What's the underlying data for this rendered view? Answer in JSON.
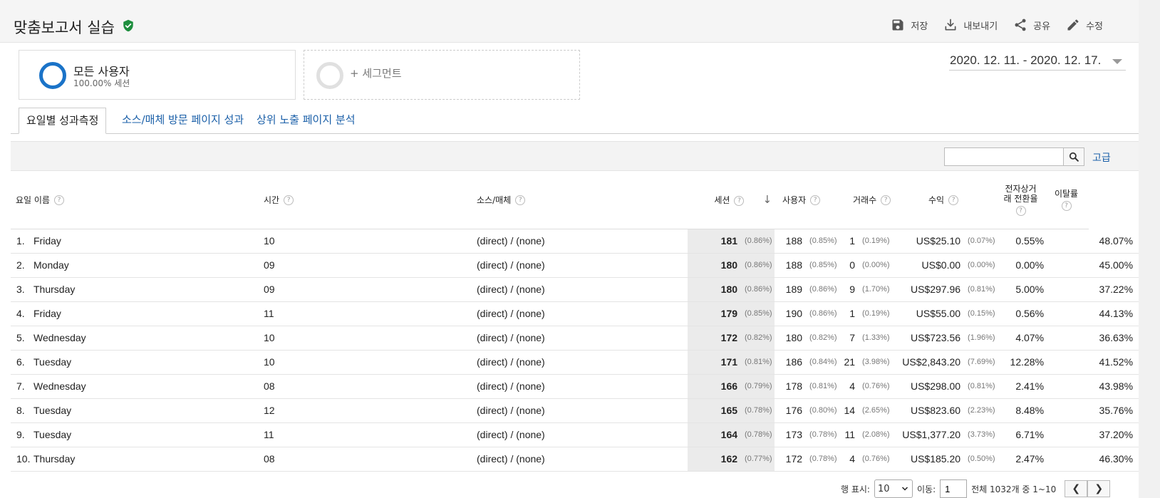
{
  "header": {
    "title": "맞춤보고서 실습",
    "actions": [
      {
        "label": "저장",
        "icon": "save-icon"
      },
      {
        "label": "내보내기",
        "icon": "download-icon"
      },
      {
        "label": "공유",
        "icon": "share-icon"
      },
      {
        "label": "수정",
        "icon": "pencil-icon"
      }
    ]
  },
  "segments": {
    "primary": {
      "name": "모든 사용자",
      "sub": "100.00% 세션"
    },
    "add_label": "+ 세그먼트"
  },
  "date_range": "2020. 12. 11. - 2020. 12. 17.",
  "tabs": [
    {
      "label": "요일별 성과측정"
    },
    {
      "label": "소스/매체 방문 페이지 성과"
    },
    {
      "label": "상위 노출 페이지 분석"
    }
  ],
  "filter": {
    "advanced_label": "고급",
    "search_placeholder": ""
  },
  "table": {
    "headers": {
      "day": "요일 이름",
      "hour": "시간",
      "source": "소스/매체",
      "sessions": "세션",
      "users": "사용자",
      "transactions": "거래수",
      "revenue": "수익",
      "conversion": "전자상거래 전환율",
      "bounce": "이탈률"
    },
    "help_mark": "?",
    "sort_arrow": "↓",
    "rows": [
      {
        "rank": "1.",
        "day": "Friday",
        "hour": "10",
        "source": "(direct) / (none)",
        "sessions": "181",
        "sessions_pct": "(0.86%)",
        "users": "188",
        "users_pct": "(0.85%)",
        "trans": "1",
        "trans_pct": "(0.19%)",
        "revenue": "US$25.10",
        "revenue_pct": "(0.07%)",
        "conv": "0.55%",
        "bounce": "48.07%"
      },
      {
        "rank": "2.",
        "day": "Monday",
        "hour": "09",
        "source": "(direct) / (none)",
        "sessions": "180",
        "sessions_pct": "(0.86%)",
        "users": "188",
        "users_pct": "(0.85%)",
        "trans": "0",
        "trans_pct": "(0.00%)",
        "revenue": "US$0.00",
        "revenue_pct": "(0.00%)",
        "conv": "0.00%",
        "bounce": "45.00%"
      },
      {
        "rank": "3.",
        "day": "Thursday",
        "hour": "09",
        "source": "(direct) / (none)",
        "sessions": "180",
        "sessions_pct": "(0.86%)",
        "users": "189",
        "users_pct": "(0.86%)",
        "trans": "9",
        "trans_pct": "(1.70%)",
        "revenue": "US$297.96",
        "revenue_pct": "(0.81%)",
        "conv": "5.00%",
        "bounce": "37.22%"
      },
      {
        "rank": "4.",
        "day": "Friday",
        "hour": "11",
        "source": "(direct) / (none)",
        "sessions": "179",
        "sessions_pct": "(0.85%)",
        "users": "190",
        "users_pct": "(0.86%)",
        "trans": "1",
        "trans_pct": "(0.19%)",
        "revenue": "US$55.00",
        "revenue_pct": "(0.15%)",
        "conv": "0.56%",
        "bounce": "44.13%"
      },
      {
        "rank": "5.",
        "day": "Wednesday",
        "hour": "10",
        "source": "(direct) / (none)",
        "sessions": "172",
        "sessions_pct": "(0.82%)",
        "users": "180",
        "users_pct": "(0.82%)",
        "trans": "7",
        "trans_pct": "(1.33%)",
        "revenue": "US$723.56",
        "revenue_pct": "(1.96%)",
        "conv": "4.07%",
        "bounce": "36.63%"
      },
      {
        "rank": "6.",
        "day": "Tuesday",
        "hour": "10",
        "source": "(direct) / (none)",
        "sessions": "171",
        "sessions_pct": "(0.81%)",
        "users": "186",
        "users_pct": "(0.84%)",
        "trans": "21",
        "trans_pct": "(3.98%)",
        "revenue": "US$2,843.20",
        "revenue_pct": "(7.69%)",
        "conv": "12.28%",
        "bounce": "41.52%"
      },
      {
        "rank": "7.",
        "day": "Wednesday",
        "hour": "08",
        "source": "(direct) / (none)",
        "sessions": "166",
        "sessions_pct": "(0.79%)",
        "users": "178",
        "users_pct": "(0.81%)",
        "trans": "4",
        "trans_pct": "(0.76%)",
        "revenue": "US$298.00",
        "revenue_pct": "(0.81%)",
        "conv": "2.41%",
        "bounce": "43.98%"
      },
      {
        "rank": "8.",
        "day": "Tuesday",
        "hour": "12",
        "source": "(direct) / (none)",
        "sessions": "165",
        "sessions_pct": "(0.78%)",
        "users": "176",
        "users_pct": "(0.80%)",
        "trans": "14",
        "trans_pct": "(2.65%)",
        "revenue": "US$823.60",
        "revenue_pct": "(2.23%)",
        "conv": "8.48%",
        "bounce": "35.76%"
      },
      {
        "rank": "9.",
        "day": "Tuesday",
        "hour": "11",
        "source": "(direct) / (none)",
        "sessions": "164",
        "sessions_pct": "(0.78%)",
        "users": "173",
        "users_pct": "(0.78%)",
        "trans": "11",
        "trans_pct": "(2.08%)",
        "revenue": "US$1,377.20",
        "revenue_pct": "(3.73%)",
        "conv": "6.71%",
        "bounce": "37.20%"
      },
      {
        "rank": "10.",
        "day": "Thursday",
        "hour": "08",
        "source": "(direct) / (none)",
        "sessions": "162",
        "sessions_pct": "(0.77%)",
        "users": "172",
        "users_pct": "(0.78%)",
        "trans": "4",
        "trans_pct": "(0.76%)",
        "revenue": "US$185.20",
        "revenue_pct": "(0.50%)",
        "conv": "2.47%",
        "bounce": "46.30%"
      }
    ]
  },
  "pagination": {
    "rows_label": "행 표시:",
    "rows_value": "10",
    "goto_label": "이동:",
    "goto_value": "1",
    "range_text": "전체 1032개 중 1~10",
    "prev_glyph": "❮",
    "next_glyph": "❯"
  },
  "colors": {
    "accent_blue": "#1a73c8",
    "link_blue": "#1a5fa8",
    "verified_green": "#1e8e3e"
  }
}
